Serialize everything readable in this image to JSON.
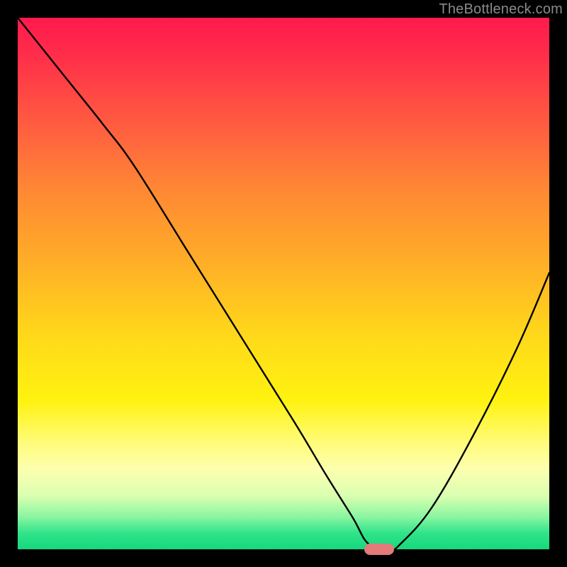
{
  "watermark": "TheBottleneck.com",
  "colors": {
    "gradient_top": "#ff1a4d",
    "gradient_mid1": "#ffab28",
    "gradient_mid2": "#fff210",
    "gradient_bottom": "#16d87d",
    "curve": "#000000",
    "dot": "#e47a7a",
    "frame": "#000000"
  },
  "chart_data": {
    "type": "line",
    "title": "",
    "xlabel": "",
    "ylabel": "",
    "xlim": [
      0,
      100
    ],
    "ylim": [
      0,
      100
    ],
    "grid": false,
    "legend": false,
    "annotations": [
      "TheBottleneck.com"
    ],
    "series": [
      {
        "name": "bottleneck-curve",
        "x": [
          0,
          8,
          16,
          22,
          32,
          42,
          52,
          58,
          63,
          66,
          70,
          72,
          78,
          86,
          94,
          100
        ],
        "values": [
          100,
          90,
          80,
          72,
          56,
          40,
          24,
          14,
          6,
          1,
          0,
          1,
          8,
          22,
          38,
          52
        ]
      }
    ],
    "marker": {
      "x": 68,
      "y": 0
    }
  }
}
